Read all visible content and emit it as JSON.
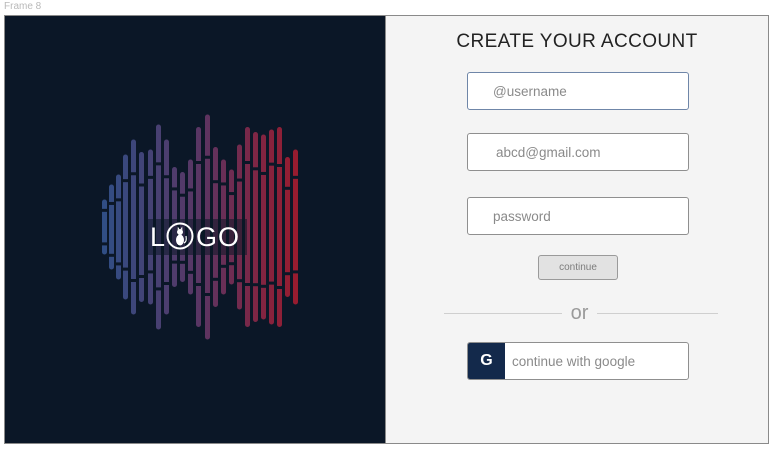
{
  "frame_label": "Frame 8",
  "logo": {
    "text_left": "L",
    "text_right": "GO",
    "icon": "cat-in-circle-icon"
  },
  "signup": {
    "title": "CREATE YOUR ACCOUNT",
    "username_placeholder": "@username",
    "email_placeholder": "abcd@gmail.com",
    "password_placeholder": "password",
    "continue_label": "continue",
    "or_label": "or",
    "google_icon_letter": "G",
    "google_label": "continue with google"
  },
  "colors": {
    "panel_background": "#0b1727",
    "equalizer_start": "#2f4f86",
    "equalizer_end": "#9a1b2d",
    "google_icon_background": "#13294b"
  }
}
